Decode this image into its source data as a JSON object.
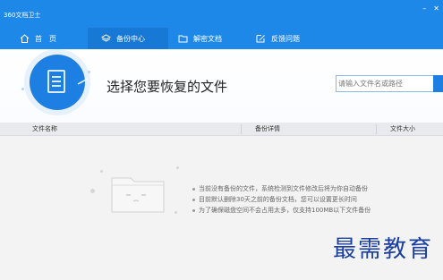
{
  "window": {
    "title": "360文档卫士"
  },
  "nav": {
    "items": [
      {
        "label": "首　页",
        "icon": "home-icon"
      },
      {
        "label": "备份中心",
        "icon": "layers-icon",
        "active": true
      },
      {
        "label": "解密文档",
        "icon": "folder-icon"
      },
      {
        "label": "反馈问题",
        "icon": "edit-icon"
      }
    ]
  },
  "header": {
    "title": "选择您要恢复的文件",
    "search_placeholder": "请输入文件名或路径"
  },
  "table": {
    "columns": [
      "文件名称",
      "备份详情",
      "文件大小"
    ]
  },
  "empty_state": {
    "messages": [
      "当前没有备份的文件，系统检测到文件修改后将为你自动备份",
      "目前默认删除30天之前的备份文档，您可以设置更长时间",
      "为了确保磁盘空间不会占用太多，仅支持100MB以下文件备份"
    ]
  },
  "watermark": {
    "text": "最需教育"
  },
  "colors": {
    "accent": "#1e88e8",
    "active_tab": "#1778d6",
    "watermark": "#1b3fa0"
  }
}
